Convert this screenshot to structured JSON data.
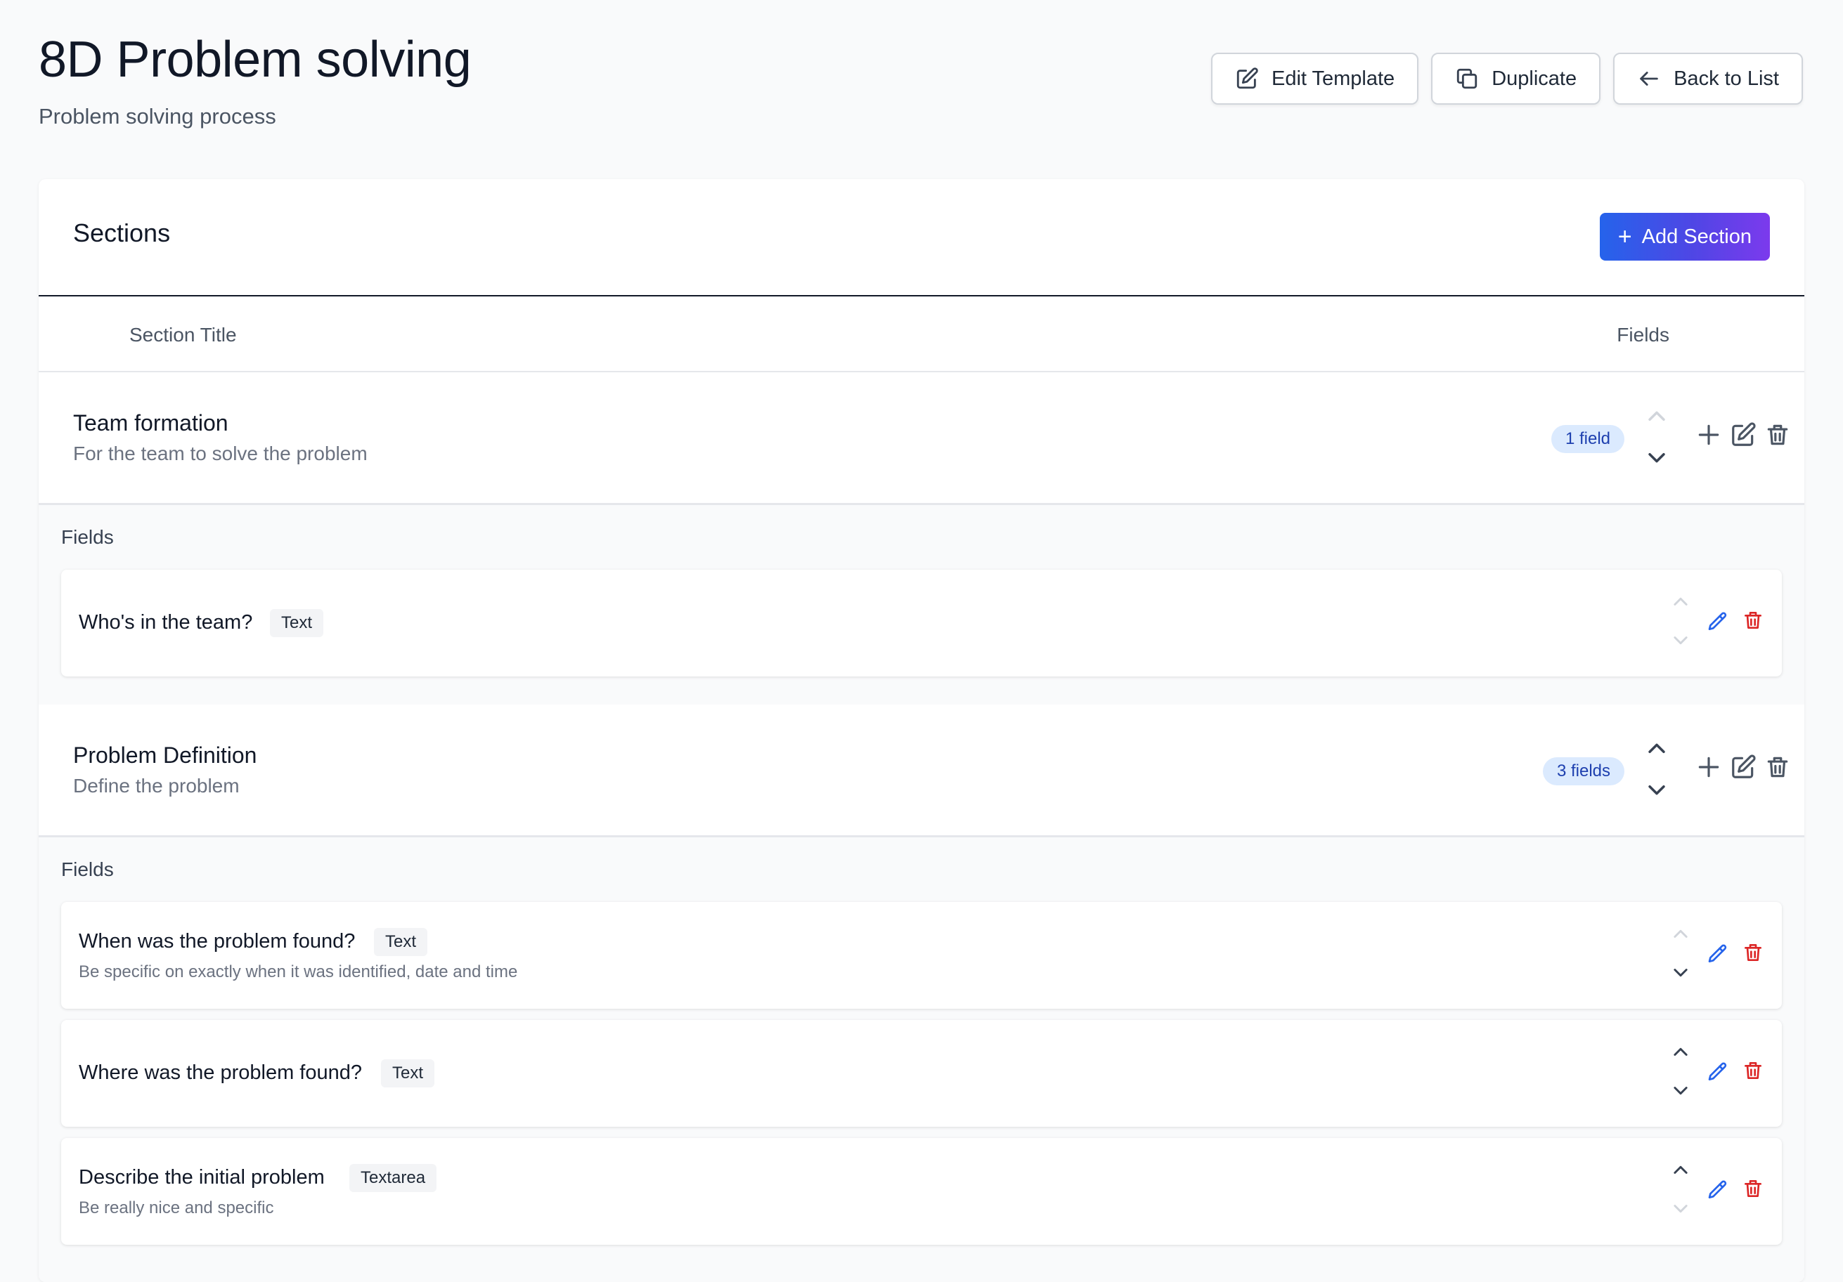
{
  "page": {
    "title": "8D Problem solving",
    "subtitle": "Problem solving process"
  },
  "actions": {
    "edit_template": "Edit Template",
    "duplicate": "Duplicate",
    "back_to_list": "Back to List"
  },
  "sections_card": {
    "title": "Sections",
    "add_section": "Add Section",
    "columns": {
      "section_title": "Section Title",
      "fields": "Fields"
    }
  },
  "sections": [
    {
      "name": "Team formation",
      "description": "For the team to solve the problem",
      "field_count": "1 field",
      "fields_label": "Fields",
      "fields": [
        {
          "name": "Who's in the team?",
          "type": "Text",
          "description": ""
        }
      ]
    },
    {
      "name": "Problem Definition",
      "description": "Define the problem",
      "field_count": "3 fields",
      "fields_label": "Fields",
      "fields": [
        {
          "name": "When was the problem found?",
          "type": "Text",
          "description": "Be specific on exactly when it was identified, date and time"
        },
        {
          "name": "Where was the problem found?",
          "type": "Text",
          "description": ""
        },
        {
          "name": "Describe the initial problem",
          "type": "Textarea",
          "description": "Be really nice and specific"
        }
      ]
    }
  ],
  "colors": {
    "accent_gradient_start": "#2563eb",
    "accent_gradient_end": "#7c3aed",
    "edit_icon": "#2563eb",
    "delete_icon": "#dc2626",
    "badge_bg": "#dbeafe",
    "badge_text": "#1e40af"
  },
  "icons": {
    "edit_template": "pencil-square-icon",
    "duplicate": "copy-icon",
    "back": "arrow-left-icon",
    "add": "plus-icon",
    "move_up": "chevron-up-icon",
    "move_down": "chevron-down-icon",
    "edit": "pencil-icon",
    "delete": "trash-icon"
  }
}
